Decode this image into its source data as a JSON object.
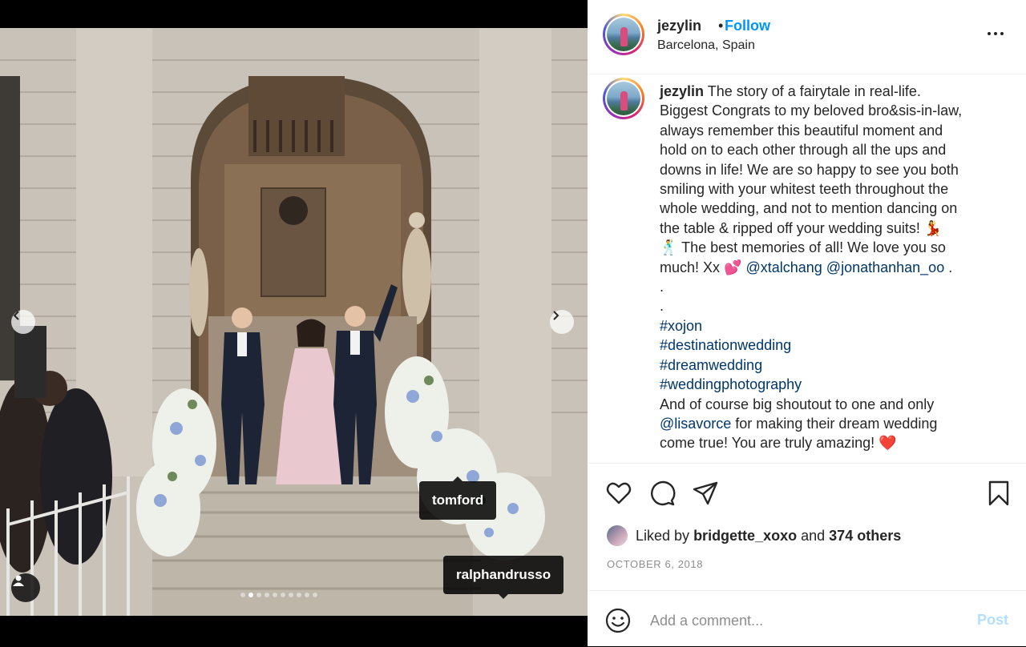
{
  "post": {
    "username": "jezylin",
    "separator": "•",
    "follow_label": "Follow",
    "location": "Barcelona, Spain",
    "caption_lines": [
      "The story of a fairytale in real-life.",
      "Biggest Congrats to my beloved bro&sis-in-law,",
      "always remember this beautiful moment and",
      "hold on to each other through all the ups and",
      "downs in life! We are so happy to see you both",
      "smiling with your whitest teeth throughout the",
      "whole wedding, and not to mention dancing on",
      "the table & ripped off your wedding suits! 💃",
      "🕺 The best memories of all! We love you so",
      "much! Xx 💕"
    ],
    "mentions": [
      "@xtalchang",
      "@jonathanhan_oo"
    ],
    "caption_end": ".",
    "dot1": ".",
    "dot2": ".",
    "hashtags": [
      "#xojon",
      "#destinationwedding",
      "#dreamwedding",
      "#weddingphotography"
    ],
    "shoutout_line1": "And of course big shoutout to one and only",
    "shoutout_mention": "@lisavorce",
    "shoutout_line2_rest": " for making their dream wedding",
    "shoutout_line3": "come true! You are truly amazing! ❤️",
    "likes": {
      "prefix": "Liked by",
      "user": "bridgette_xoxo",
      "middle": "and",
      "others": "374 others"
    },
    "date": "OCTOBER 6, 2018",
    "comment_placeholder": "Add a comment...",
    "post_label": "Post"
  },
  "media": {
    "tags": [
      "tomford",
      "ralphandrusso"
    ],
    "carousel": {
      "total": 10,
      "active": 2
    }
  },
  "icons": {
    "more": "more-horizontal-icon",
    "heart": "heart-icon",
    "comment": "comment-icon",
    "share": "share-icon",
    "save": "bookmark-icon",
    "emoji": "emoji-icon",
    "user_tags": "user-tag-icon",
    "prev": "chevron-left-icon",
    "next": "chevron-right-icon"
  },
  "colors": {
    "follow": "#0095f6",
    "link": "#00376b",
    "muted": "#8e8e8e",
    "post_disabled": "#b2dffc"
  }
}
